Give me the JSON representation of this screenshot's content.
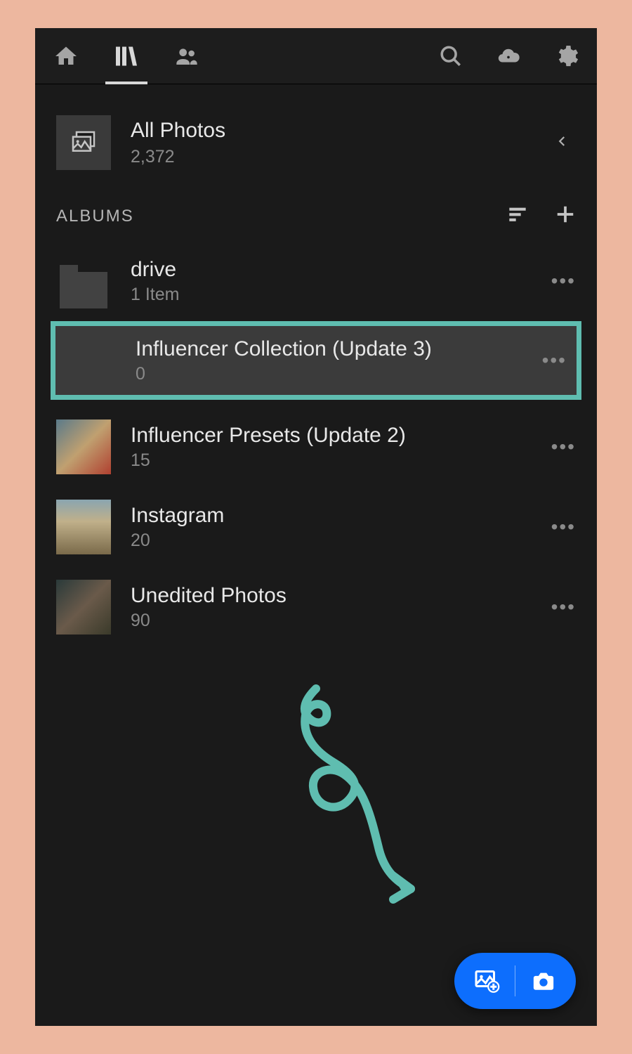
{
  "allPhotos": {
    "title": "All Photos",
    "count": "2,372"
  },
  "sectionLabel": "ALBUMS",
  "albums": [
    {
      "name": "drive",
      "count": "1 Item",
      "type": "folder"
    },
    {
      "name": "Influencer Collection (Update 3)",
      "count": "0",
      "type": "empty",
      "highlight": true
    },
    {
      "name": "Influencer Presets (Update 2)",
      "count": "15",
      "type": "photo"
    },
    {
      "name": "Instagram",
      "count": "20",
      "type": "photo"
    },
    {
      "name": "Unedited Photos",
      "count": "90",
      "type": "photo"
    }
  ],
  "colors": {
    "highlightBorder": "#5fbdb0",
    "fab": "#0d6efd",
    "pageBg": "#edb79f"
  }
}
